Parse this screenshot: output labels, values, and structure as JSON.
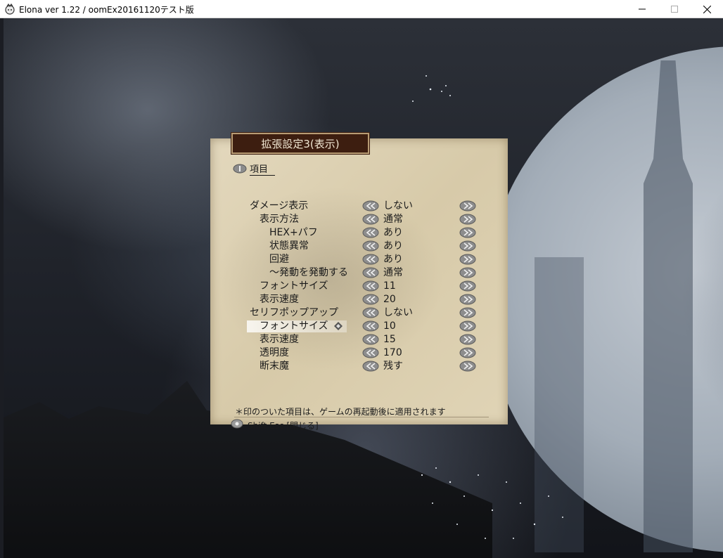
{
  "window": {
    "title": "Elona ver 1.22 / oomEx20161120テスト版",
    "icon": "elona-app-icon",
    "controls": [
      "minimize-icon",
      "maximize-icon",
      "close-icon"
    ]
  },
  "dialog": {
    "title": "拡張設定3(表示)",
    "section_label": "項目",
    "items": [
      {
        "label": "ダメージ表示",
        "value": "しない"
      },
      {
        "label": "表示方法",
        "value": "通常"
      },
      {
        "label": "HEX+パフ",
        "value": "あり"
      },
      {
        "label": "状態異常",
        "value": "あり"
      },
      {
        "label": "回避",
        "value": "あり"
      },
      {
        "label": "～発動を発動する",
        "value": "通常"
      },
      {
        "label": "フォントサイズ",
        "value": "11"
      },
      {
        "label": "表示速度",
        "value": "20"
      },
      {
        "label": "セリフポップアップ",
        "value": "しない"
      },
      {
        "label": "フォントサイズ",
        "value": "10"
      },
      {
        "label": "表示速度",
        "value": "15"
      },
      {
        "label": "透明度",
        "value": "170"
      },
      {
        "label": "断末魔",
        "value": "残す"
      }
    ],
    "selected_index": 9,
    "note": "＊印のついた項目は、ゲームの再起動後に適用されます",
    "help": "Shift,Esc [閉じる]",
    "icons": {
      "decrease": "double-left-arrow-icon",
      "increase": "double-right-arrow-icon",
      "selection": "diamond-cursor-icon",
      "section": "bullet-icon",
      "help": "key-icon"
    }
  },
  "colors": {
    "title_plate": "#3d1e10",
    "parchment": "#e3d8bd",
    "text": "#1b1b1b"
  }
}
